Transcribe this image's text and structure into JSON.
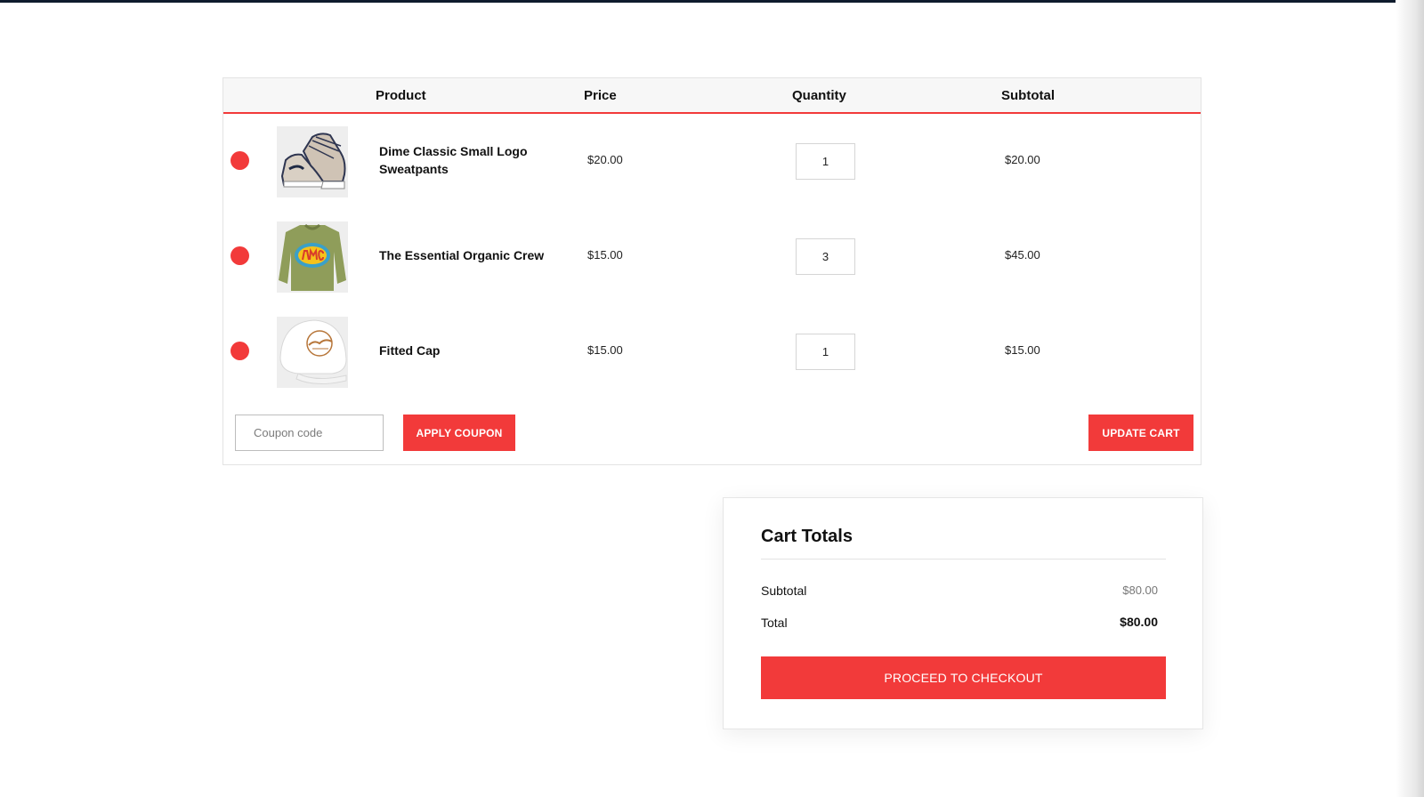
{
  "table": {
    "headers": {
      "product": "Product",
      "price": "Price",
      "quantity": "Quantity",
      "subtotal": "Subtotal"
    },
    "rows": [
      {
        "name": "Dime Classic Small Logo Sweatpants",
        "price": "$20.00",
        "quantity": "1",
        "subtotal": "$20.00",
        "image": "sneakers-image"
      },
      {
        "name": "The Essential Organic Crew",
        "price": "$15.00",
        "quantity": "3",
        "subtotal": "$45.00",
        "image": "omg-sweater-image"
      },
      {
        "name": "Fitted Cap",
        "price": "$15.00",
        "quantity": "1",
        "subtotal": "$15.00",
        "image": "mockup-cap-image"
      }
    ]
  },
  "coupon": {
    "placeholder": "Coupon code",
    "value": "",
    "apply_label": "APPLY COUPON"
  },
  "update_cart_label": "UPDATE CART",
  "cart_totals": {
    "title": "Cart Totals",
    "subtotal_label": "Subtotal",
    "subtotal_value": "$80.00",
    "total_label": "Total",
    "total_value": "$80.00",
    "checkout_label": "PROCEED TO CHECKOUT"
  },
  "colors": {
    "accent": "#f23a3a",
    "top_bar": "#0f1b2d",
    "table_header_bg": "#f7f7f7"
  }
}
